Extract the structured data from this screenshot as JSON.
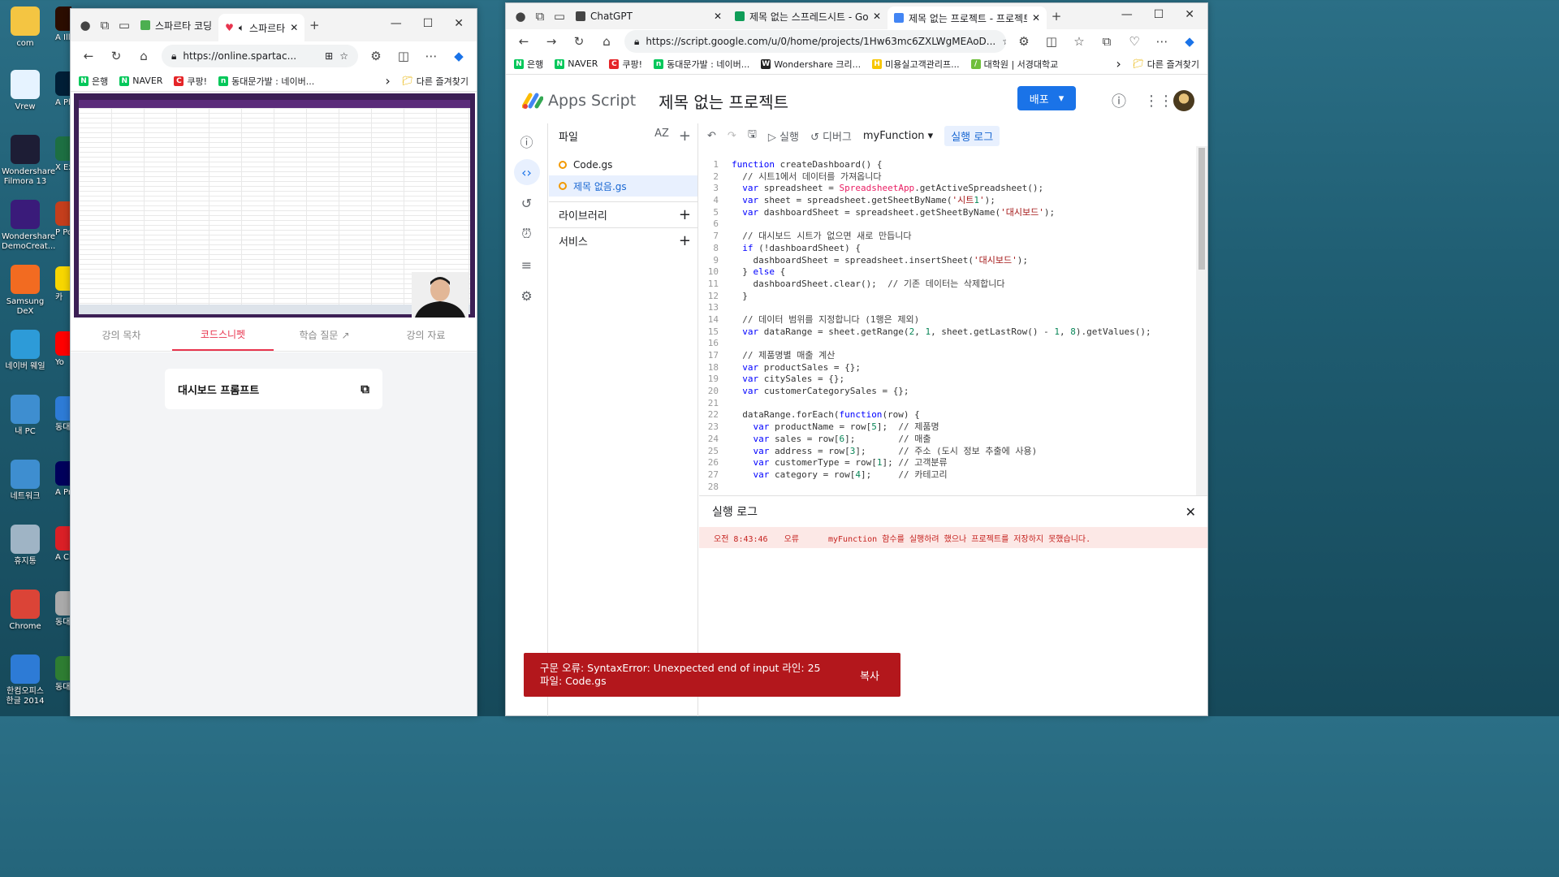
{
  "desktop": {
    "icons": [
      {
        "label": "com",
        "color": "#f4c542"
      },
      {
        "label": "Vrew",
        "color": "#e6f3ff"
      },
      {
        "label": "Wondershare Filmora 13",
        "color": "#1d1d35"
      },
      {
        "label": "Wondershare DemoCreat...",
        "color": "#3a1b7a"
      },
      {
        "label": "Samsung DeX",
        "color": "#f26b21"
      },
      {
        "label": "네이버 웨일",
        "color": "#2d9bd8"
      },
      {
        "label": "내 PC",
        "color": "#3e8ed0"
      },
      {
        "label": "네트워크",
        "color": "#3e8ed0"
      },
      {
        "label": "휴지통",
        "color": "#9fb4c5"
      },
      {
        "label": "Chrome",
        "color": "#db4437"
      },
      {
        "label": "한컴오피스 한글 2014",
        "color": "#2d7bd6"
      }
    ],
    "icons_col2": [
      {
        "label": "A Illus",
        "color": "#2b0d00"
      },
      {
        "label": "A Phot",
        "color": "#001e36"
      },
      {
        "label": "X Exce",
        "color": "#1d6f42"
      },
      {
        "label": "P Pow",
        "color": "#c43e1c"
      },
      {
        "label": "카",
        "color": "#f7d600"
      },
      {
        "label": "Yo",
        "color": "#ff0000"
      },
      {
        "label": "동대 카카",
        "color": "#2d7bd6"
      },
      {
        "label": "A Prem",
        "color": "#00005b"
      },
      {
        "label": "A Cr",
        "color": "#da1f26"
      },
      {
        "label": "동대 계약",
        "color": "#aaaaaa"
      },
      {
        "label": "동대 카카",
        "color": "#2e7d32"
      }
    ]
  },
  "left_browser": {
    "tabs": [
      {
        "label": "스파르타 코딩",
        "color": "#4caf50"
      },
      {
        "label": "스파르타",
        "color": "#e8344e"
      }
    ],
    "url": "https://online.spartac...",
    "bookmarks": [
      {
        "label": "은행",
        "icon": "N",
        "color": "#03c75a"
      },
      {
        "label": "NAVER",
        "icon": "N",
        "color": "#03c75a"
      },
      {
        "label": "쿠팡!",
        "icon": "C",
        "color": "#e52528"
      },
      {
        "label": "동대문가발 : 네이버...",
        "icon": "n",
        "color": "#03c75a"
      }
    ],
    "other_bookmarks": "다른 즐겨찾기",
    "lecture_tabs": [
      "강의 목차",
      "코드스니펫",
      "학습 질문",
      "강의 자료"
    ],
    "active_lecture_tab": 1,
    "card_title": "대시보드 프롬프트"
  },
  "right_browser": {
    "tabs": [
      {
        "label": "ChatGPT",
        "color": "#444444"
      },
      {
        "label": "제목 없는 스프레드시트 - Google",
        "color": "#0f9d58"
      },
      {
        "label": "제목 없는 프로젝트 - 프로젝트 편",
        "color": "#4285f4"
      }
    ],
    "url": "https://script.google.com/u/0/home/projects/1Hw63mc6ZXLWgMEAoD...",
    "bookmarks": [
      {
        "label": "은행",
        "icon": "N",
        "color": "#03c75a"
      },
      {
        "label": "NAVER",
        "icon": "N",
        "color": "#03c75a"
      },
      {
        "label": "쿠팡!",
        "icon": "C",
        "color": "#e52528"
      },
      {
        "label": "동대문가발 : 네이버...",
        "icon": "n",
        "color": "#03c75a"
      },
      {
        "label": "Wondershare 크리...",
        "icon": "W",
        "color": "#222222"
      },
      {
        "label": "미용실고객관리프...",
        "icon": "H",
        "color": "#f7c600"
      },
      {
        "label": "대학원 | 서경대학교",
        "icon": "/",
        "color": "#6fbf3b"
      }
    ],
    "other_bookmarks": "다른 즐겨찾기"
  },
  "apps_script": {
    "app_name": "Apps Script",
    "project_title": "제목 없는 프로젝트",
    "deploy_label": "배포",
    "files_header": "파일",
    "files": [
      "Code.gs",
      "제목 없음.gs"
    ],
    "active_file": 1,
    "libraries_label": "라이브러리",
    "services_label": "서비스",
    "toolbar": {
      "run": "실행",
      "debug": "디버그",
      "function": "myFunction",
      "run_log": "실행 로그"
    },
    "code_lines": [
      "function createDashboard() {",
      "  // 시트1에서 데이터를 가져옵니다",
      "  var spreadsheet = SpreadsheetApp.getActiveSpreadsheet();",
      "  var sheet = spreadsheet.getSheetByName('시트1');",
      "  var dashboardSheet = spreadsheet.getSheetByName('대시보드');",
      "",
      "  // 대시보드 시트가 없으면 새로 만듭니다",
      "  if (!dashboardSheet) {",
      "    dashboardSheet = spreadsheet.insertSheet('대시보드');",
      "  } else {",
      "    dashboardSheet.clear();  // 기존 데이터는 삭제합니다",
      "  }",
      "",
      "  // 데이터 범위를 지정합니다 (1행은 제외)",
      "  var dataRange = sheet.getRange(2, 1, sheet.getLastRow() - 1, 8).getValues();",
      "",
      "  // 제품명별 매출 계산",
      "  var productSales = {};",
      "  var citySales = {};",
      "  var customerCategorySales = {};",
      "",
      "  dataRange.forEach(function(row) {",
      "    var productName = row[5];  // 제품명",
      "    var sales = row[6];        // 매출",
      "    var address = row[3];      // 주소 (도시 정보 추출에 사용)",
      "    var customerType = row[1]; // 고객분류",
      "    var category = row[4];     // 카테고리",
      ""
    ],
    "log": {
      "title": "실행 로그",
      "time": "오전 8:43:46",
      "level": "오류",
      "message": "myFunction 함수를 실행하려 했으나 프로젝트를 저장하지 못했습니다."
    },
    "toast": {
      "message": "구문 오류: SyntaxError: Unexpected end of input 라인: 25 파일: Code.gs",
      "action": "복사"
    }
  }
}
